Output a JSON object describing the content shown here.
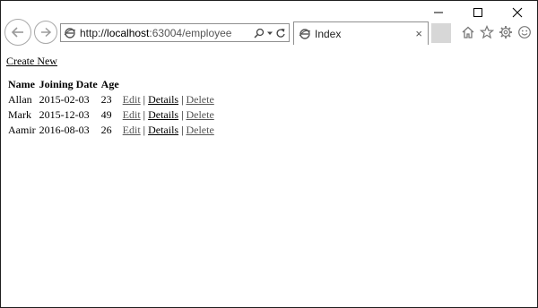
{
  "browser": {
    "address_prefix": "http://",
    "address_host": "localhost",
    "address_path": ":63004/employee",
    "tab_title": "Index",
    "tab_close": "×"
  },
  "page": {
    "create_new_label": "Create New",
    "columns": [
      "Name",
      "Joining Date",
      "Age",
      ""
    ],
    "rows": [
      {
        "name": "Allan",
        "joining_date": "2015-02-03",
        "age": "23"
      },
      {
        "name": "Mark",
        "joining_date": "2015-12-03",
        "age": "49"
      },
      {
        "name": "Aamir",
        "joining_date": "2016-08-03",
        "age": "26"
      }
    ],
    "actions": {
      "edit": "Edit",
      "details": "Details",
      "delete": "Delete",
      "separator": "|"
    }
  },
  "icons": {
    "back": "back-arrow-icon",
    "forward": "forward-arrow-icon",
    "page": "ie-page-icon",
    "search": "search-icon",
    "dropdown": "chevron-down-icon",
    "refresh": "refresh-icon",
    "home": "home-icon",
    "favorites": "star-icon",
    "settings": "gear-icon",
    "feedback": "smiley-icon",
    "minimize": "minimize-icon",
    "maximize": "maximize-icon",
    "close": "close-icon"
  },
  "colors": {
    "window_border": "#1f1f1f",
    "chrome_border": "#8f8f8f",
    "new_tab_bg": "#d7d7d7",
    "link": "#000000",
    "grey_link": "#555555"
  }
}
